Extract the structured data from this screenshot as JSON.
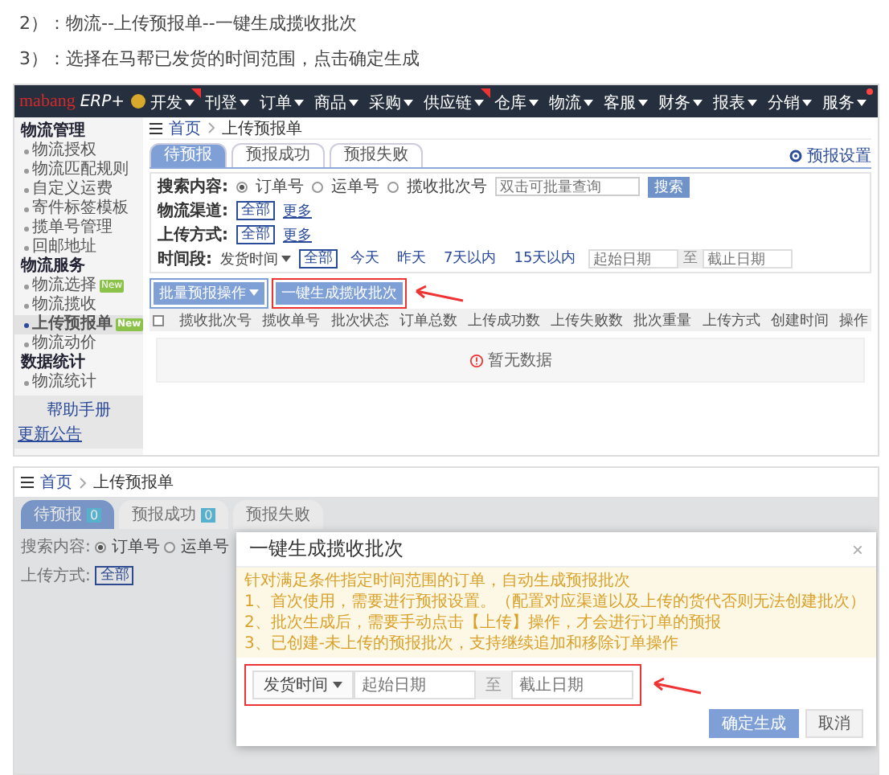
{
  "steps": [
    "2）：物流--上传预报单--一键生成揽收批次",
    "3）：选择在马帮已发货的时间范围，点击确定生成"
  ],
  "shot1": {
    "logo": {
      "brand": "mabang",
      "product": "ERP+"
    },
    "nav": [
      {
        "label": "开发",
        "ribbon": true,
        "dot": false
      },
      {
        "label": "刊登",
        "ribbon": false,
        "dot": false
      },
      {
        "label": "订单",
        "ribbon": false,
        "dot": false
      },
      {
        "label": "商品",
        "ribbon": false,
        "dot": false
      },
      {
        "label": "采购",
        "ribbon": false,
        "dot": false
      },
      {
        "label": "供应链",
        "ribbon": true,
        "dot": false
      },
      {
        "label": "仓库",
        "ribbon": false,
        "dot": false
      },
      {
        "label": "物流",
        "ribbon": false,
        "dot": false
      },
      {
        "label": "客服",
        "ribbon": false,
        "dot": false
      },
      {
        "label": "财务",
        "ribbon": false,
        "dot": false
      },
      {
        "label": "报表",
        "ribbon": false,
        "dot": false
      },
      {
        "label": "分销",
        "ribbon": false,
        "dot": false
      },
      {
        "label": "服务",
        "ribbon": false,
        "dot": true
      }
    ],
    "sidebar": [
      {
        "title": "物流管理",
        "items": [
          {
            "label": "物流授权",
            "selected": false
          },
          {
            "label": "物流匹配规则",
            "selected": false
          },
          {
            "label": "自定义运费",
            "selected": false
          },
          {
            "label": "寄件标签模板",
            "selected": false
          },
          {
            "label": "揽单号管理",
            "selected": false
          },
          {
            "label": "回邮地址",
            "selected": false
          }
        ]
      },
      {
        "title": "物流服务",
        "items": [
          {
            "label": "物流选择",
            "selected": false,
            "badge": "New"
          },
          {
            "label": "物流揽收",
            "selected": false
          },
          {
            "label": "上传预报单",
            "selected": true,
            "badge": "New"
          },
          {
            "label": "物流动价",
            "selected": false
          }
        ]
      },
      {
        "title": "数据统计",
        "items": [
          {
            "label": "物流统计",
            "selected": false
          }
        ]
      }
    ],
    "help": "帮助手册",
    "notice_link": "更新公告",
    "breadcrumb": [
      "首页",
      "上传预报单"
    ],
    "tabs": [
      {
        "label": "待预报",
        "selected": true
      },
      {
        "label": "预报成功",
        "selected": false
      },
      {
        "label": "预报失败",
        "selected": false
      }
    ],
    "settings_link": "预报设置",
    "search": {
      "label": "搜索内容:",
      "options": [
        {
          "label": "订单号",
          "selected": true
        },
        {
          "label": "运单号",
          "selected": false
        },
        {
          "label": "揽收批次号",
          "selected": false
        }
      ],
      "placeholder": "双击可批量查询",
      "button": "搜索"
    },
    "filters": [
      {
        "label": "物流渠道:",
        "chips": [
          {
            "label": "全部",
            "selected": true
          }
        ],
        "more": "更多"
      },
      {
        "label": "上传方式:",
        "chips": [
          {
            "label": "全部",
            "selected": true
          }
        ],
        "more": "更多"
      }
    ],
    "time": {
      "label": "时间段:",
      "field": "发货时间",
      "chips": [
        {
          "label": "全部",
          "selected": true
        },
        {
          "label": "今天",
          "selected": false
        },
        {
          "label": "昨天",
          "selected": false
        },
        {
          "label": "7天以内",
          "selected": false
        },
        {
          "label": "15天以内",
          "selected": false
        }
      ],
      "start": {
        "placeholder": "起始日期"
      },
      "to": "至",
      "end": {
        "placeholder": "截止日期"
      }
    },
    "actions": [
      {
        "label": "批量预报操作",
        "kind": "dropdown",
        "highlighted": false
      },
      {
        "label": "一键生成揽收批次",
        "kind": "plain",
        "highlighted": true
      }
    ],
    "select_all": {
      "checked": false
    },
    "columns": [
      "揽收批次号",
      "揽收单号",
      "批次状态",
      "订单总数",
      "上传成功数",
      "上传失败数",
      "批次重量",
      "上传方式",
      "创建时间",
      "操作"
    ],
    "empty": "暂无数据"
  },
  "shot2": {
    "breadcrumb": [
      "首页",
      "上传预报单"
    ],
    "tabs": [
      {
        "label": "待预报",
        "count": "0",
        "selected": true
      },
      {
        "label": "预报成功",
        "count": "0",
        "selected": false
      },
      {
        "label": "预报失败",
        "selected": false
      }
    ],
    "search": {
      "label": "搜索内容:",
      "options": [
        {
          "label": "订单号",
          "selected": true
        },
        {
          "label": "运单号",
          "selected": false
        }
      ]
    },
    "upload": {
      "label": "上传方式:",
      "chip": {
        "label": "全部",
        "selected": true
      }
    },
    "dialog": {
      "title": "一键生成揽收批次",
      "close": "×",
      "notice": [
        "针对满足条件指定时间范围的订单，自动生成预报批次",
        "1、首次使用，需要进行预报设置。（配置对应渠道以及上传的货代否则无法创建批次）",
        "2、批次生成后，需要手动点击【上传】操作，才会进行订单的预报",
        "3、已创建-未上传的预报批次，支持继续追加和移除订单操作"
      ],
      "date": {
        "field": "发货时间",
        "start": {
          "placeholder": "起始日期"
        },
        "to": "至",
        "end": {
          "placeholder": "截止日期"
        },
        "highlighted": true
      },
      "buttons": [
        {
          "label": "确定生成",
          "kind": "primary"
        },
        {
          "label": "取消",
          "kind": "default"
        }
      ]
    }
  }
}
